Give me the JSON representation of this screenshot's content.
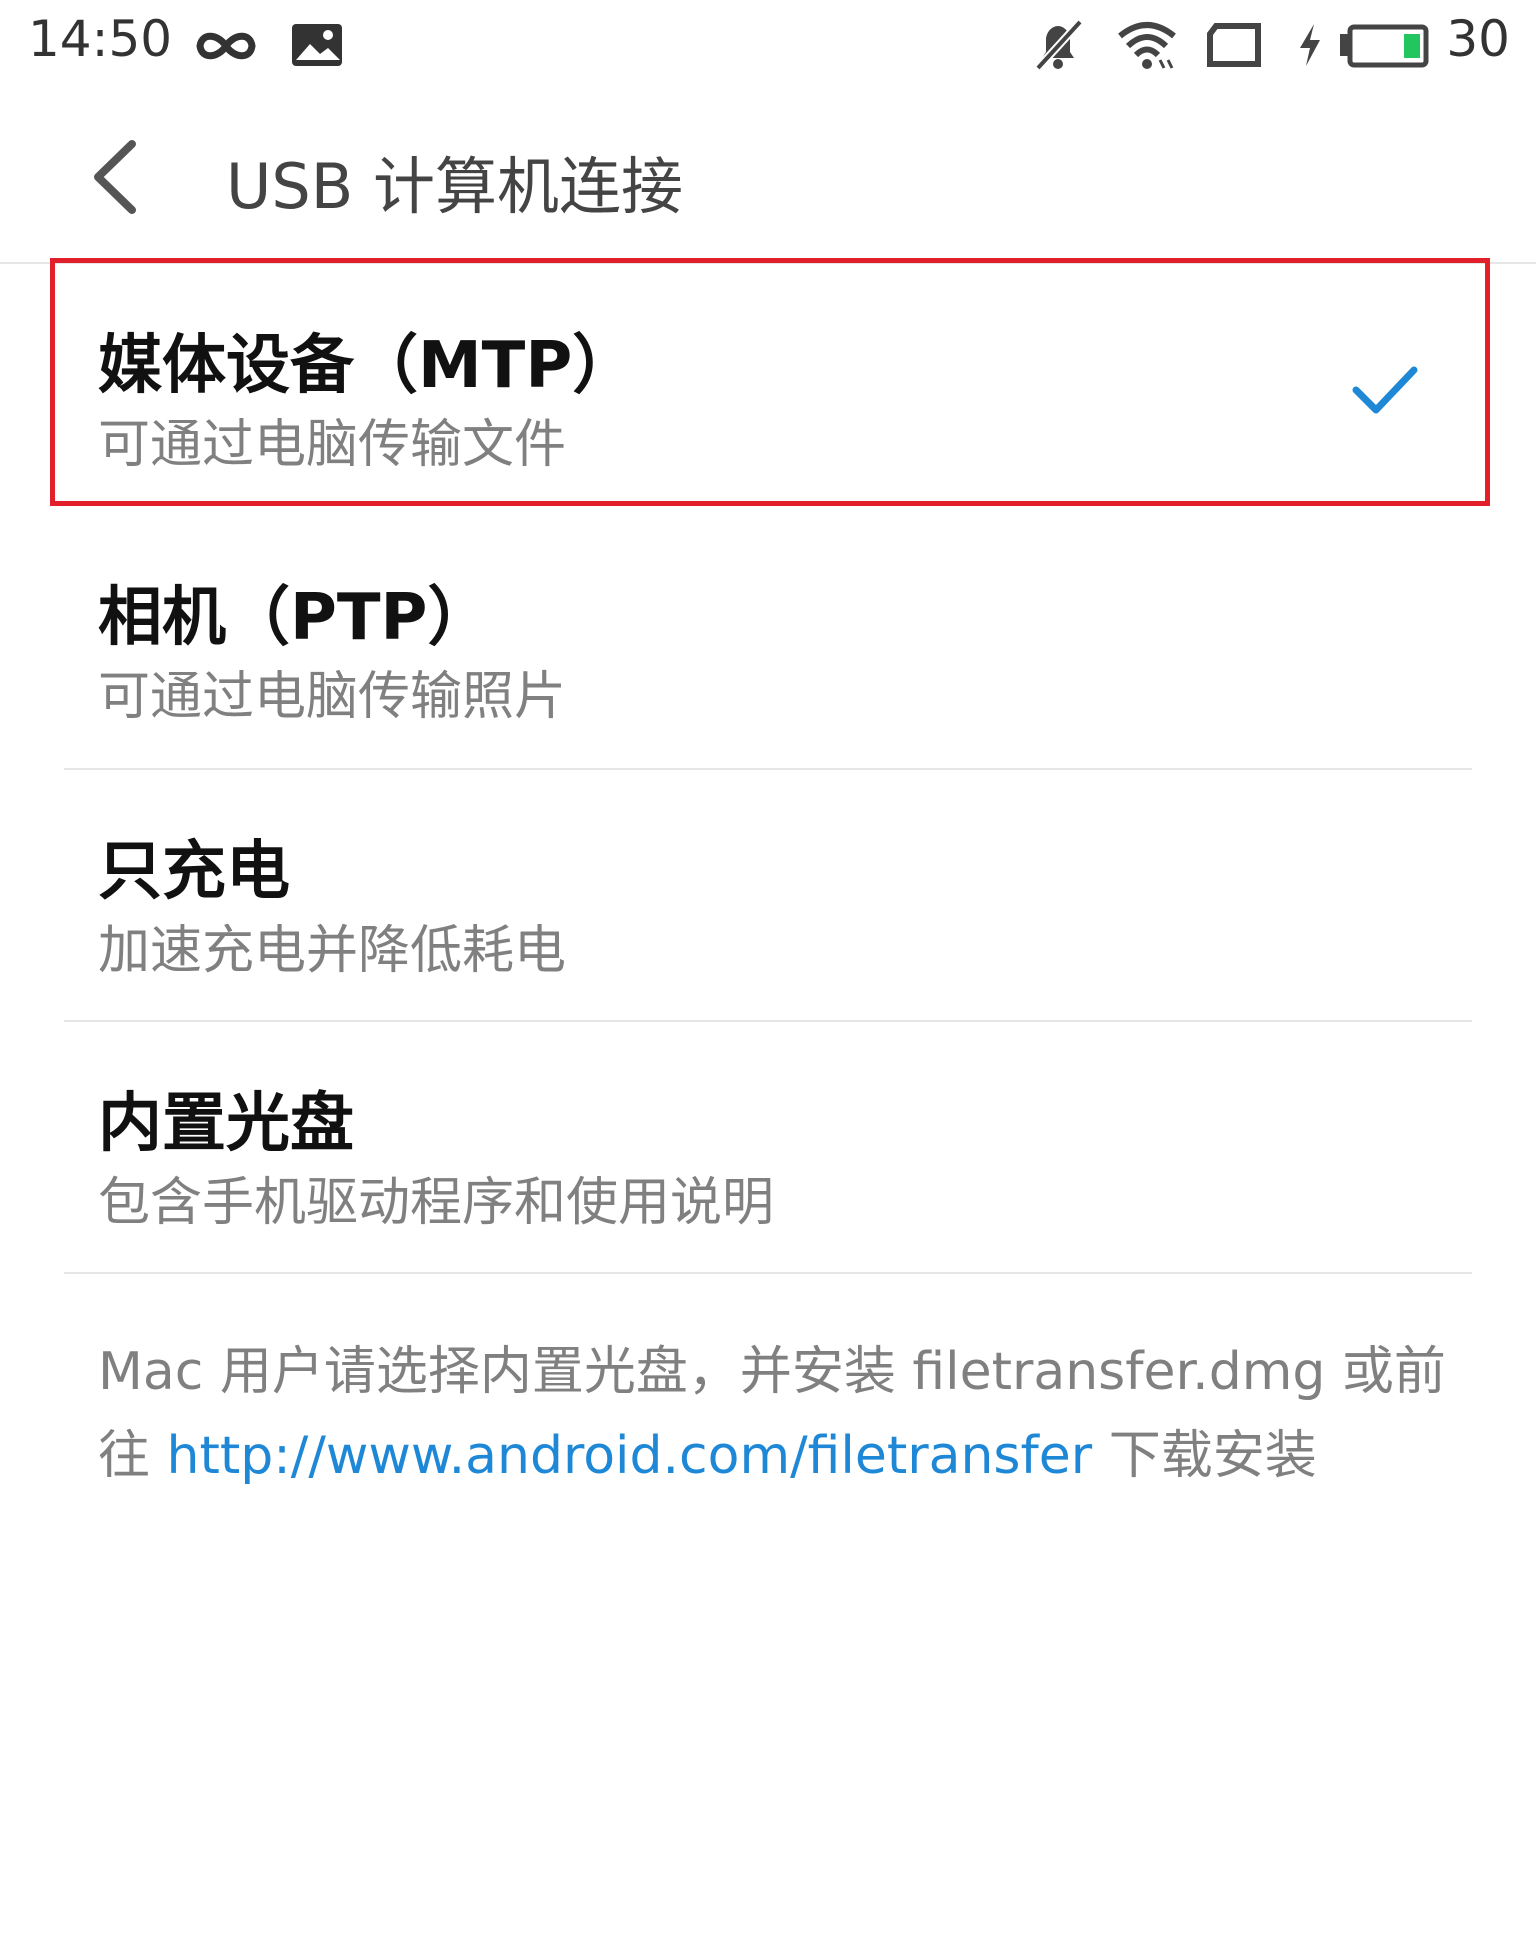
{
  "status_bar": {
    "time": "14:50",
    "battery_percent": "30",
    "battery_color": "#22c55e",
    "icons": [
      "infinity-icon",
      "image-icon",
      "mute-bell-icon",
      "wifi-icon",
      "screen-icon",
      "charging-bolt-icon",
      "battery-icon"
    ]
  },
  "app_bar": {
    "title": "USB 计算机连接",
    "back_icon": "chevron-left-icon"
  },
  "options": [
    {
      "title": "媒体设备（MTP）",
      "subtitle": "可通过电脑传输文件",
      "selected": true
    },
    {
      "title": "相机（PTP）",
      "subtitle": "可通过电脑传输照片",
      "selected": false
    },
    {
      "title": "只充电",
      "subtitle": "加速充电并降低耗电",
      "selected": false
    },
    {
      "title": "内置光盘",
      "subtitle": "包含手机驱动程序和使用说明",
      "selected": false
    }
  ],
  "note": {
    "text_before": "Mac 用户请选择内置光盘，并安装 filetransfer.dmg 或前往 ",
    "link": "http://www.android.com/filetransfer",
    "text_after": " 下载安装"
  },
  "colors": {
    "accent": "#1e88d6",
    "highlight": "#e2202c"
  }
}
